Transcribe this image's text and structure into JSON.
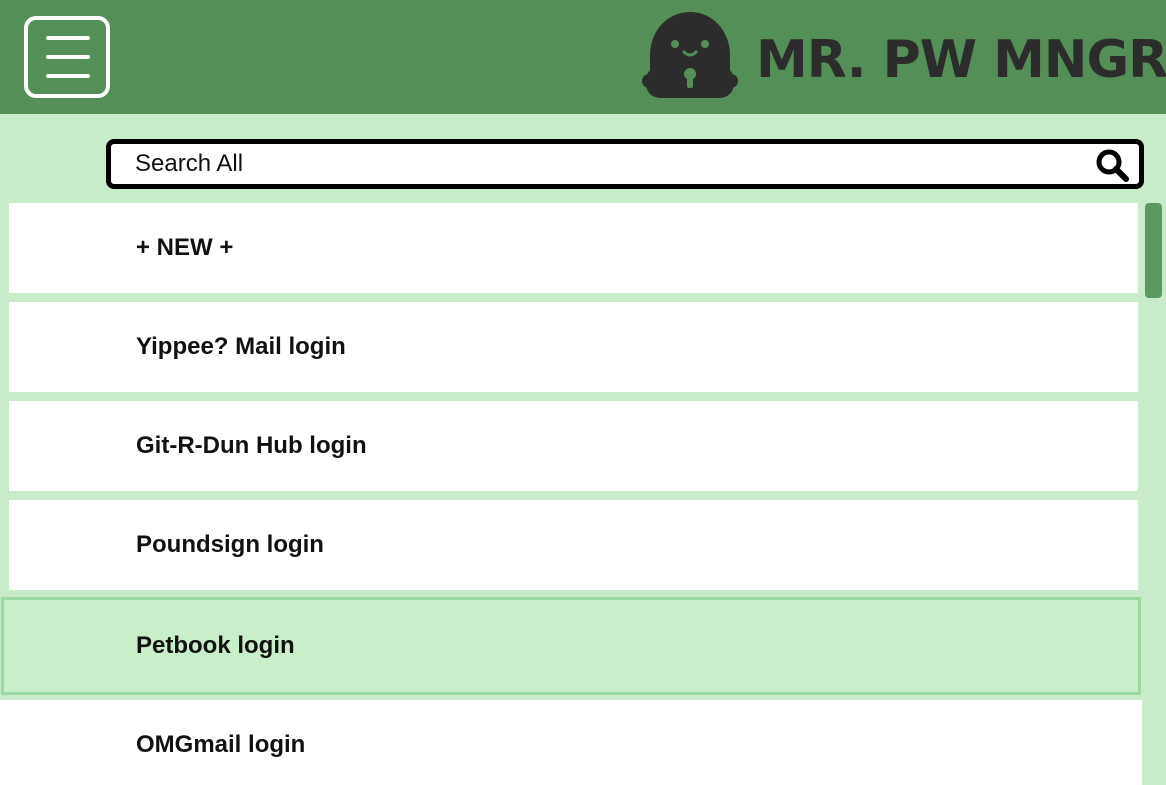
{
  "header": {
    "app_title": "MR. PW MNGR",
    "menu_icon": "hamburger-menu-icon",
    "logo_icon": "robot-padlock-icon"
  },
  "search": {
    "placeholder": "Search All",
    "value": "",
    "icon": "search-icon"
  },
  "list": {
    "items": [
      {
        "label": "+ NEW +"
      },
      {
        "label": "Yippee? Mail login"
      },
      {
        "label": "Git-R-Dun Hub login"
      },
      {
        "label": "Poundsign login"
      },
      {
        "label": "Petbook login",
        "selected": true
      },
      {
        "label": "OMGmail login"
      }
    ]
  },
  "colors": {
    "header_bg": "#558f58",
    "page_bg": "#c8ecca",
    "selected_bg": "#c8eeca",
    "selected_border": "#9ad89d",
    "scroll_thumb": "#5a9a60",
    "title_text": "#2c2c2c"
  }
}
